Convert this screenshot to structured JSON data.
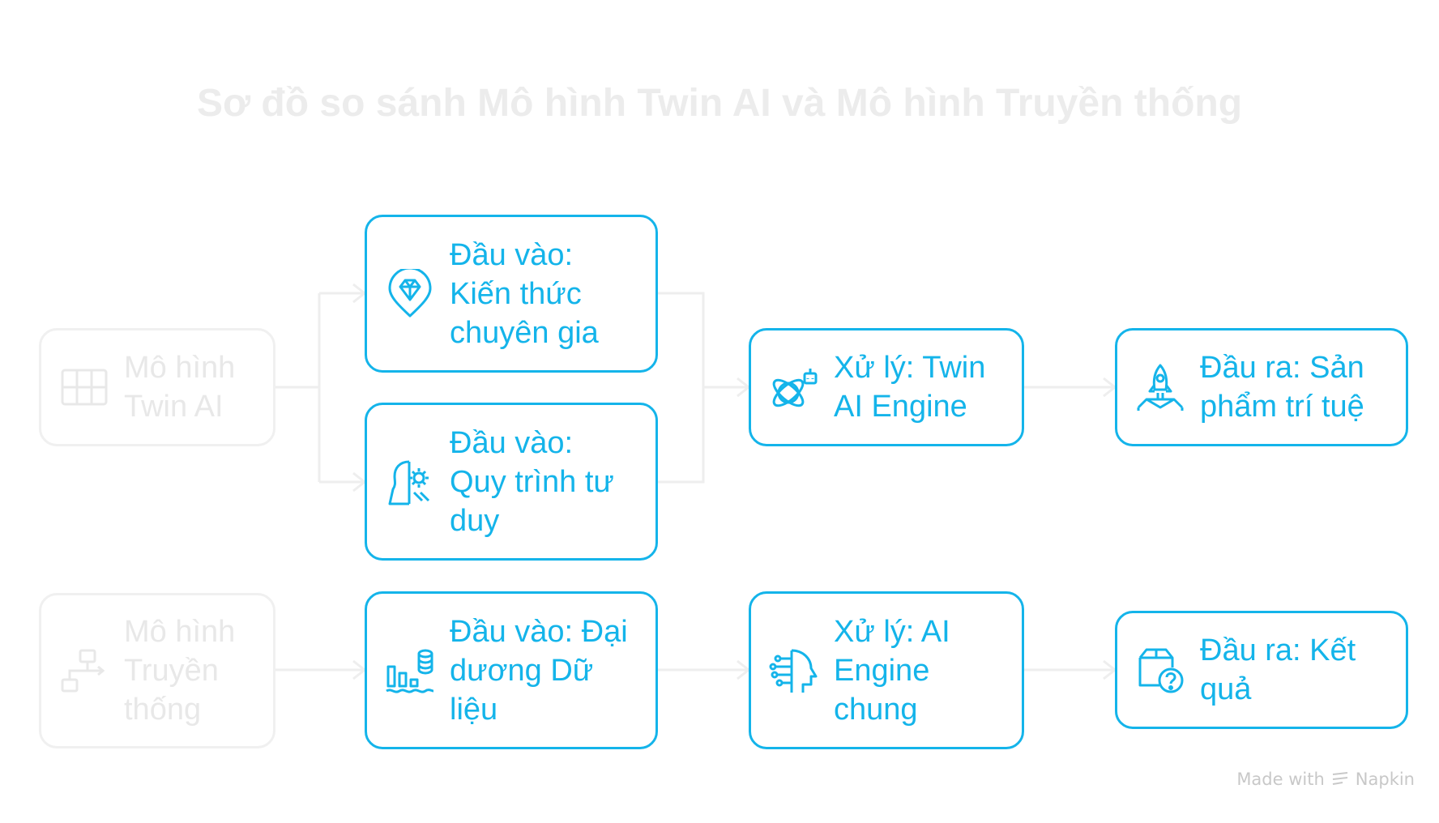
{
  "title": "Sơ đồ so sánh Mô hình Twin AI và Mô hình Truyền thống",
  "colors": {
    "accent": "#14b4ea",
    "faded": "#e8e8e8",
    "connector": "#eeeeee"
  },
  "nodes": {
    "twin_ai": {
      "label": "Mô hình Twin AI",
      "icon": "grid-icon"
    },
    "traditional": {
      "label": "Mô hình Truyền thống",
      "icon": "flowchart-icon"
    },
    "input_knowledge": {
      "label": "Đầu vào: Kiến thức chuyên gia",
      "icon": "diamond-pin-icon"
    },
    "input_thinking": {
      "label": "Đầu vào: Quy trình tư duy",
      "icon": "head-gear-icon"
    },
    "input_data_ocean": {
      "label": "Đầu vào: Đại dương Dữ liệu",
      "icon": "data-ocean-icon"
    },
    "process_twin": {
      "label": "Xử lý: Twin AI Engine",
      "icon": "robot-orbit-icon"
    },
    "process_generic": {
      "label": "Xử lý: AI Engine chung",
      "icon": "circuit-head-icon"
    },
    "output_ip": {
      "label": "Đầu ra: Sản phẩm trí tuệ",
      "icon": "rocket-icon"
    },
    "output_result": {
      "label": "Đầu ra: Kết quả",
      "icon": "box-question-icon"
    }
  },
  "footer": {
    "made_with": "Made with",
    "brand": "Napkin"
  }
}
